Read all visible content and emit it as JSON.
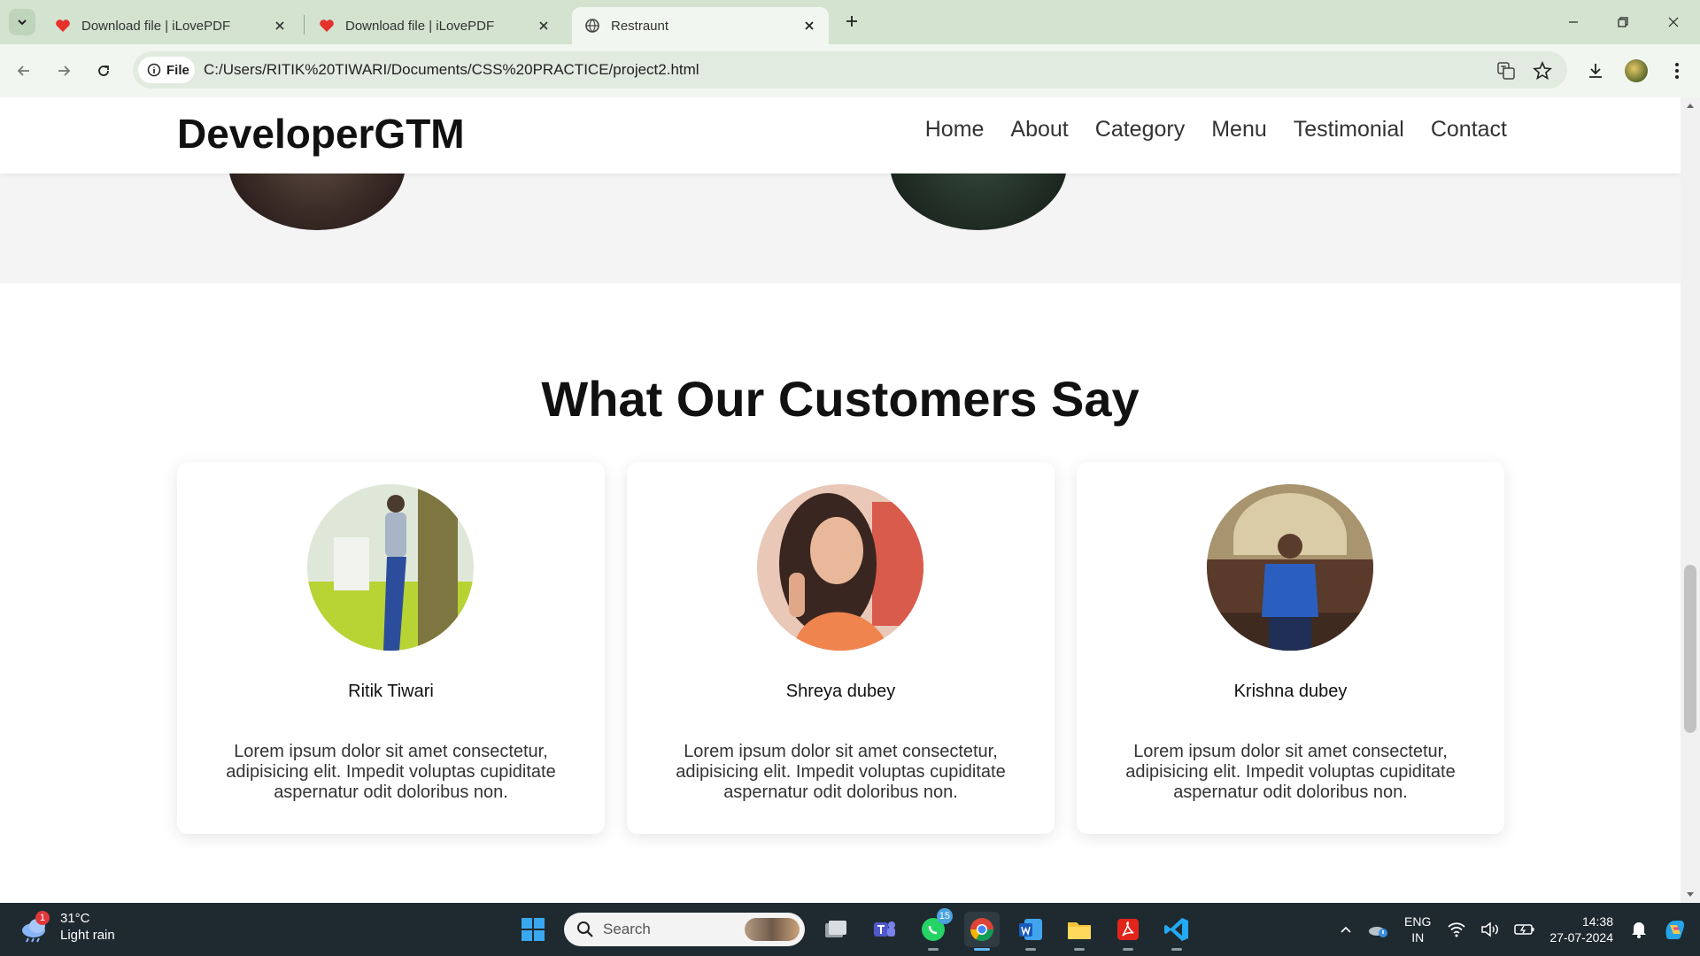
{
  "browser": {
    "tabs": [
      {
        "title": "Download file | iLovePDF",
        "icon": "ilovepdf-heart-icon"
      },
      {
        "title": "Download file | iLovePDF",
        "icon": "ilovepdf-heart-icon"
      },
      {
        "title": "Restraunt",
        "icon": "globe-icon"
      }
    ],
    "address": {
      "chip_label": "File",
      "url": "C:/Users/RITIK%20TIWARI/Documents/CSS%20PRACTICE/project2.html"
    }
  },
  "site": {
    "logo": "DeveloperGTM",
    "nav": [
      "Home",
      "About",
      "Category",
      "Menu",
      "Testimonial",
      "Contact"
    ],
    "testimonials_title": "What Our Customers Say",
    "testimonials": [
      {
        "name": "Ritik Tiwari",
        "text": "Lorem ipsum dolor sit amet consectetur, adipisicing elit. Impedit voluptas cupiditate aspernatur odit doloribus non."
      },
      {
        "name": "Shreya dubey",
        "text": "Lorem ipsum dolor sit amet consectetur, adipisicing elit. Impedit voluptas cupiditate aspernatur odit doloribus non."
      },
      {
        "name": "Krishna dubey",
        "text": "Lorem ipsum dolor sit amet consectetur, adipisicing elit. Impedit voluptas cupiditate aspernatur odit doloribus non."
      }
    ]
  },
  "taskbar": {
    "weather": {
      "badge": "1",
      "temp": "31°C",
      "condition": "Light rain"
    },
    "search_placeholder": "Search",
    "whatsapp_badge": "15",
    "lang": {
      "line1": "ENG",
      "line2": "IN"
    },
    "clock": {
      "time": "14:38",
      "date": "27-07-2024"
    }
  },
  "colors": {
    "tabstrip": "#d3e3cf",
    "toolbar": "#f2f6f0",
    "taskbar": "#1f2a30",
    "accent": "#5fb7f2"
  }
}
